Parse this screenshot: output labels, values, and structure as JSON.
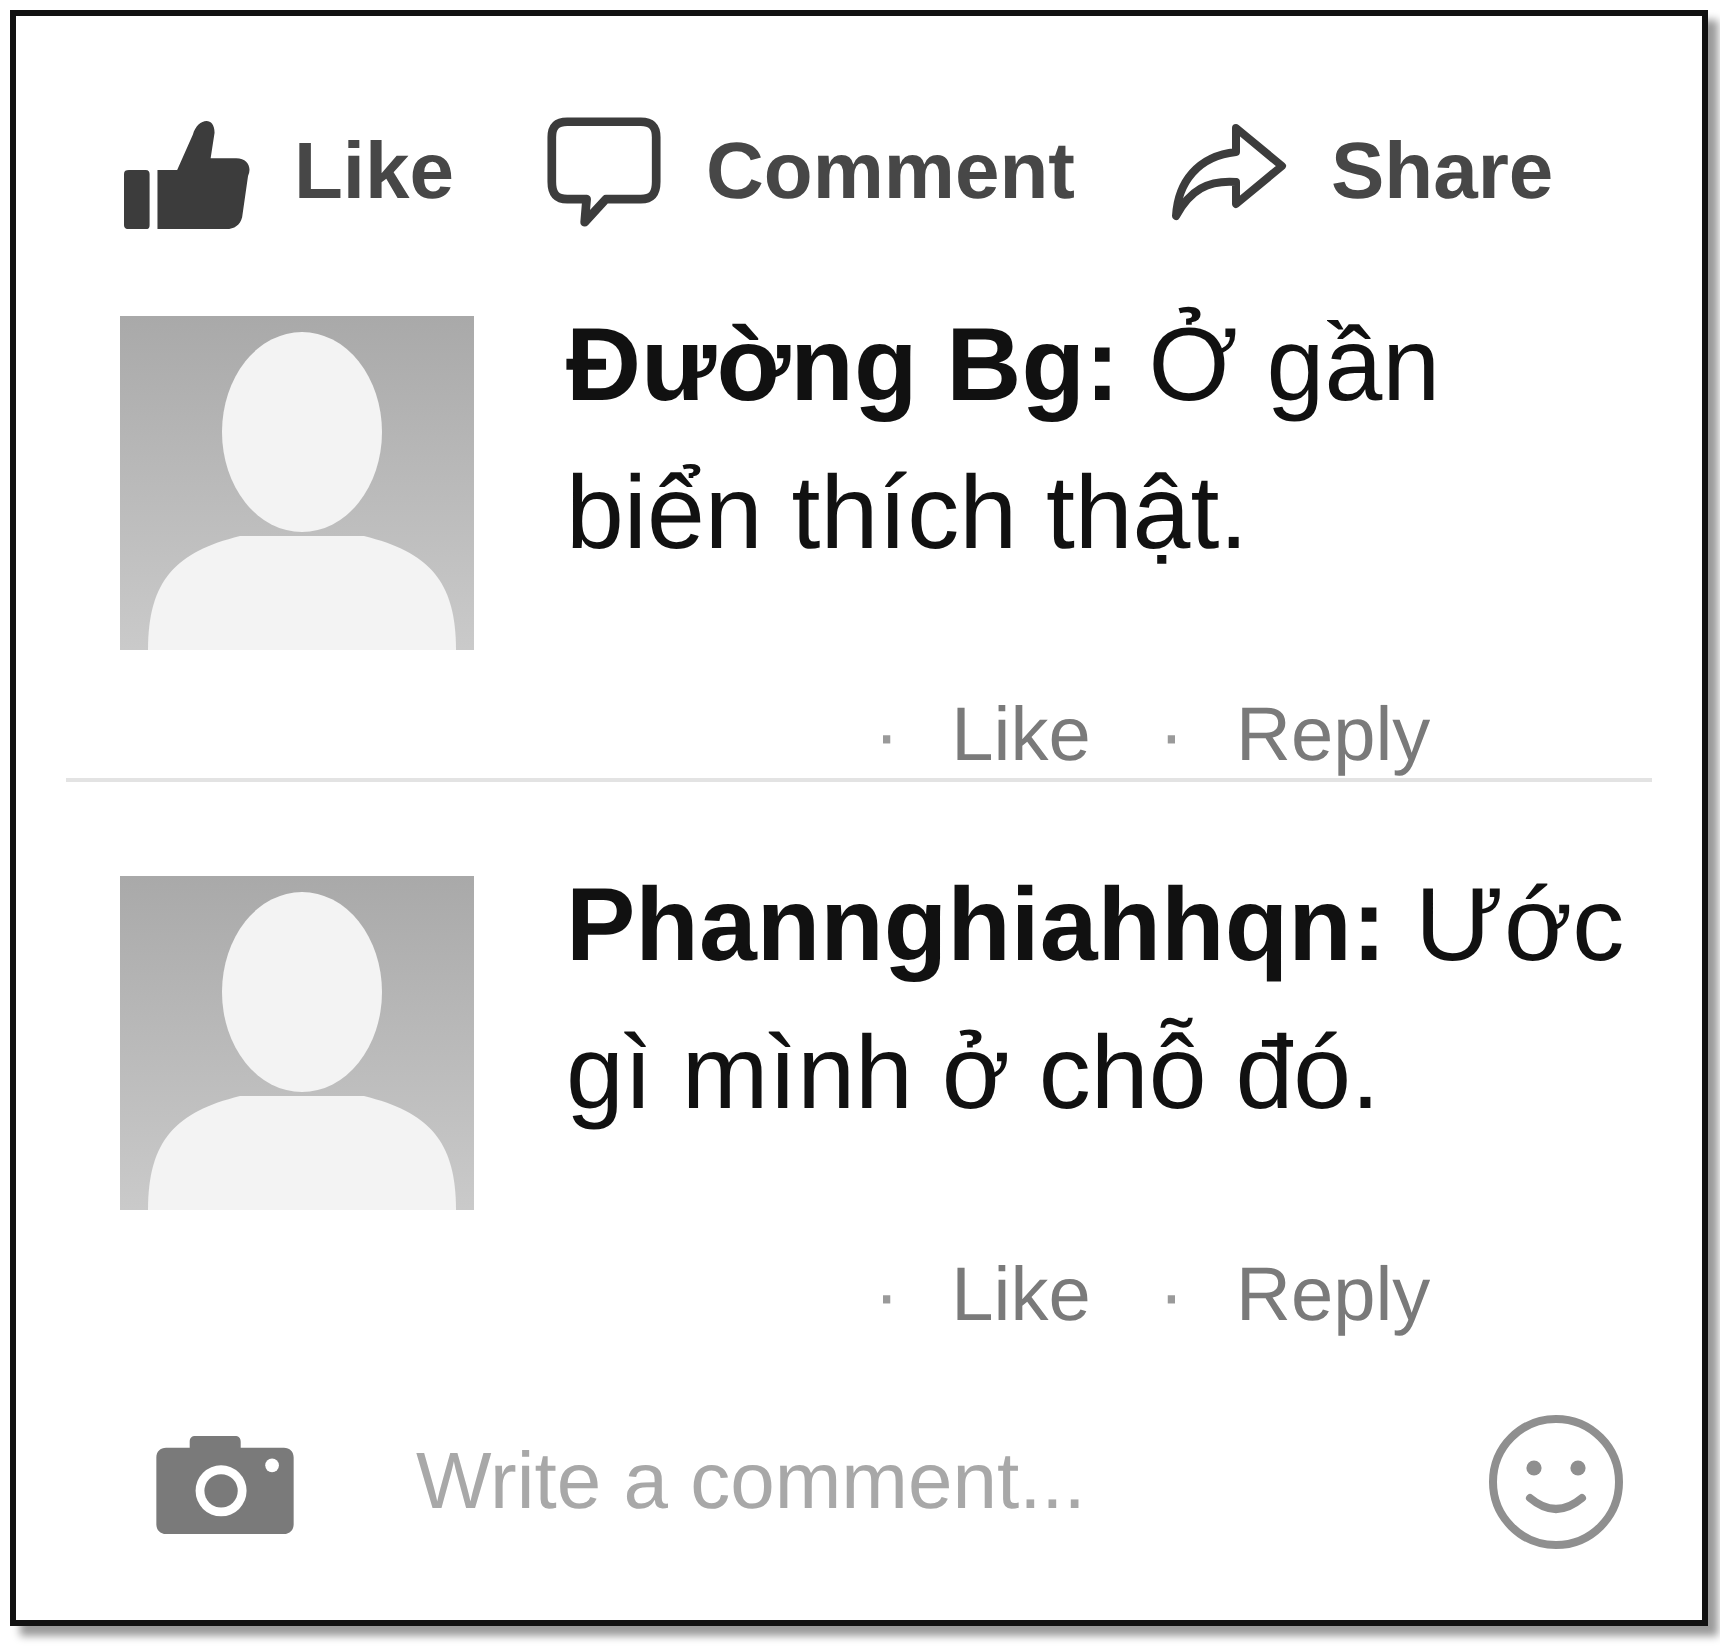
{
  "actions": [
    {
      "kind": "like",
      "label": "Like"
    },
    {
      "kind": "comment",
      "label": "Comment"
    },
    {
      "kind": "share",
      "label": "Share"
    }
  ],
  "comments": [
    {
      "text": "**Đường Bg:** Ở gần biển thích thật.",
      "links": [
        {
          "sep": "·",
          "label": "Like"
        },
        {
          "sep": "·",
          "label": "Reply"
        }
      ]
    },
    {
      "text": "**Phannghiahhqn:** Ước gì mình ở chỗ đó.",
      "links": [
        {
          "sep": "·",
          "label": "Like"
        },
        {
          "sep": "·",
          "label": "Reply"
        }
      ]
    }
  ],
  "composer": {
    "placeholder": "Write a comment..."
  }
}
